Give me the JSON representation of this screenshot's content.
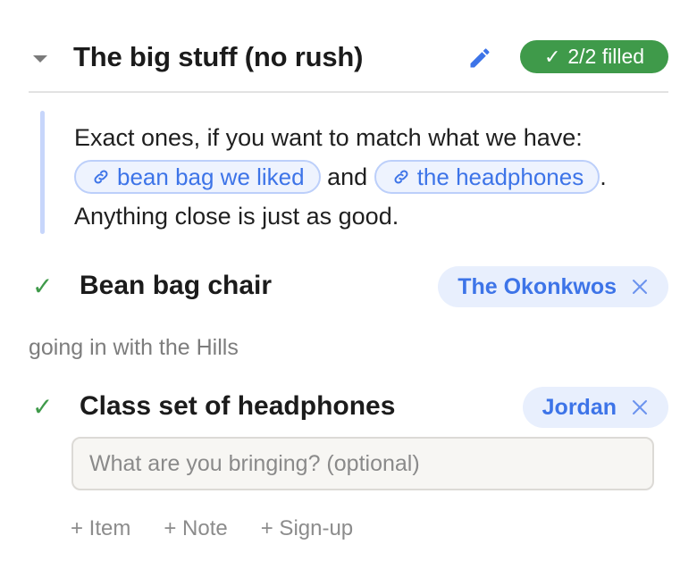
{
  "section": {
    "title": "The big stuff (no rush)",
    "badge": {
      "check": "✓",
      "label": "2/2 filled",
      "color": "#3f9a4a"
    },
    "edit_icon": "pencil-icon",
    "collapse_icon": "caret-down-icon"
  },
  "note": {
    "line1": "Exact ones, if you want to match what we have:",
    "link1": "bean bag we liked",
    "conjunction": "and",
    "link2": "the headphones",
    "period": ".",
    "line3": "Anything close is just as good.",
    "link_icon": "link-icon"
  },
  "items": [
    {
      "check": "✓",
      "name": "Bean bag chair",
      "assignee": "The Okonkwos",
      "remove_icon": "close-icon"
    },
    {
      "check": "✓",
      "name": "Class set of headphones",
      "assignee": "Jordan",
      "remove_icon": "close-icon"
    }
  ],
  "group_note": "going in with the Hills",
  "bring_input": {
    "placeholder": "What are you bringing? (optional)",
    "value": ""
  },
  "actions": {
    "item": "+ Item",
    "note": "+ Note",
    "signup": "+ Sign-up"
  },
  "colors": {
    "accent": "#3d74e8",
    "success": "#3f9a4a",
    "chip_bg": "#e8effd"
  }
}
